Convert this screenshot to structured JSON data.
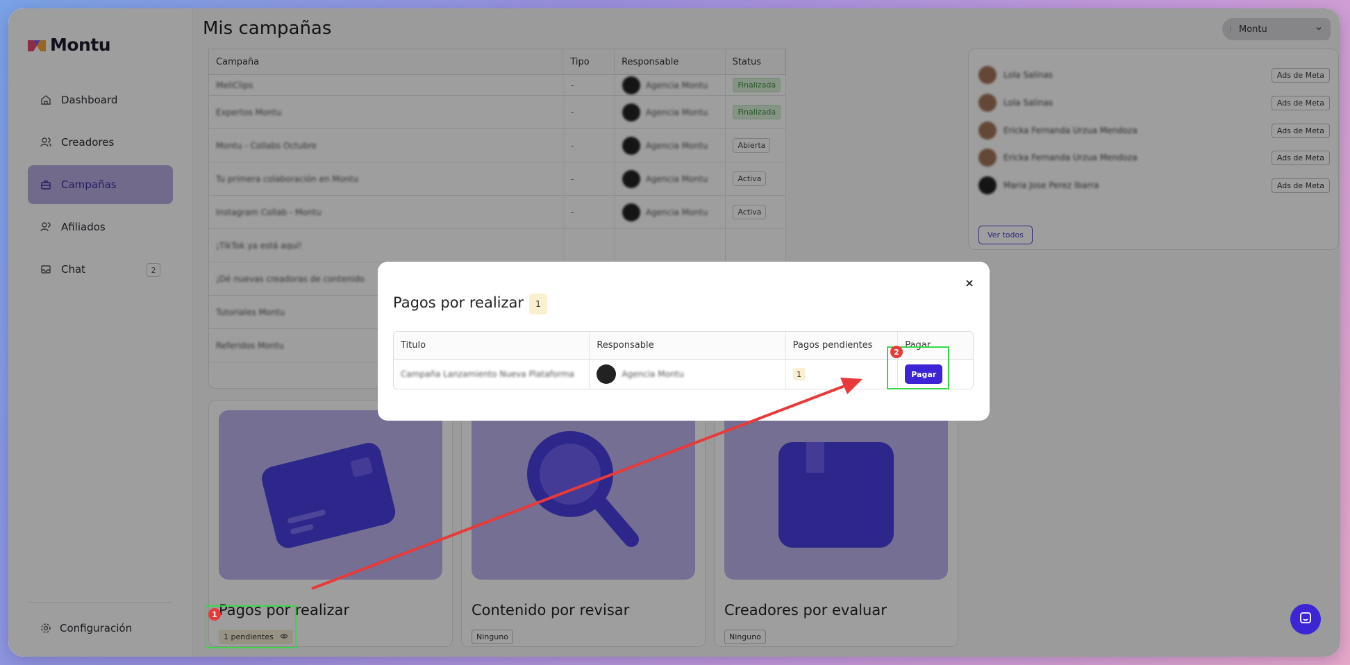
{
  "app": {
    "brand": "Montu"
  },
  "sidebar": {
    "items": [
      {
        "label": "Dashboard",
        "icon": "home-icon"
      },
      {
        "label": "Creadores",
        "icon": "users-icon"
      },
      {
        "label": "Campañas",
        "icon": "briefcase-icon",
        "active": true
      },
      {
        "label": "Afiliados",
        "icon": "user-group-icon"
      },
      {
        "label": "Chat",
        "icon": "inbox-icon",
        "badge": "2"
      }
    ],
    "settings_label": "Configuración"
  },
  "header": {
    "title": "Mis campañas",
    "user": "Montu"
  },
  "campaigns_table": {
    "columns": [
      "Campaña",
      "Tipo",
      "Responsable",
      "Status"
    ],
    "rows": [
      {
        "name": "MeliClips",
        "type": "-",
        "owner": "Agencia Montu",
        "status": "Finalizada"
      },
      {
        "name": "Expertos Montu",
        "type": "-",
        "owner": "Agencia Montu",
        "status": "Finalizada"
      },
      {
        "name": "Montu - Collabs Octubre",
        "type": "-",
        "owner": "Agencia Montu",
        "status": "Abierta"
      },
      {
        "name": "Tu primera colaboración en Montu",
        "type": "-",
        "owner": "Agencia Montu",
        "status": "Activa"
      },
      {
        "name": "Instagram Collab - Montu",
        "type": "-",
        "owner": "Agencia Montu",
        "status": "Activa"
      },
      {
        "name": "¡TikTok ya está aquí!",
        "type": "",
        "owner": "",
        "status": ""
      },
      {
        "name": "¡Dé nuevas creadoras de contenido",
        "type": "",
        "owner": "",
        "status": ""
      },
      {
        "name": "Tutoriales Montu",
        "type": "",
        "owner": "",
        "status": ""
      },
      {
        "name": "Referidos Montu",
        "type": "",
        "owner": "",
        "status": ""
      }
    ]
  },
  "creators_panel": {
    "rows": [
      {
        "name": "Lola Salinas",
        "tag": "Ads de Meta"
      },
      {
        "name": "Lola Salinas",
        "tag": "Ads de Meta"
      },
      {
        "name": "Ericka Fernanda Urzua Mendoza",
        "tag": "Ads de Meta"
      },
      {
        "name": "Ericka Fernanda Urzua Mendoza",
        "tag": "Ads de Meta"
      },
      {
        "name": "Maria Jose Perez Ibarra",
        "tag": "Ads de Meta"
      }
    ],
    "see_all": "Ver todos"
  },
  "stat_cards": [
    {
      "title": "Pagos por realizar",
      "tag": "1 pendientes"
    },
    {
      "title": "Contenido por revisar",
      "tag": "Ninguno"
    },
    {
      "title": "Creadores por evaluar",
      "tag": "Ninguno"
    }
  ],
  "modal": {
    "title": "Pagos por realizar",
    "count": "1",
    "columns": [
      "Titulo",
      "Responsable",
      "Pagos pendientes",
      "Pagar"
    ],
    "row": {
      "title": "Campaña Lanzamiento Nueva Plataforma",
      "owner": "Agencia Montu",
      "pending": "1",
      "action": "Pagar"
    }
  },
  "annotations": [
    "1",
    "2"
  ],
  "colors": {
    "accent": "#3b25d4",
    "highlight": "#39d64a",
    "arrow": "#e83a3a"
  }
}
